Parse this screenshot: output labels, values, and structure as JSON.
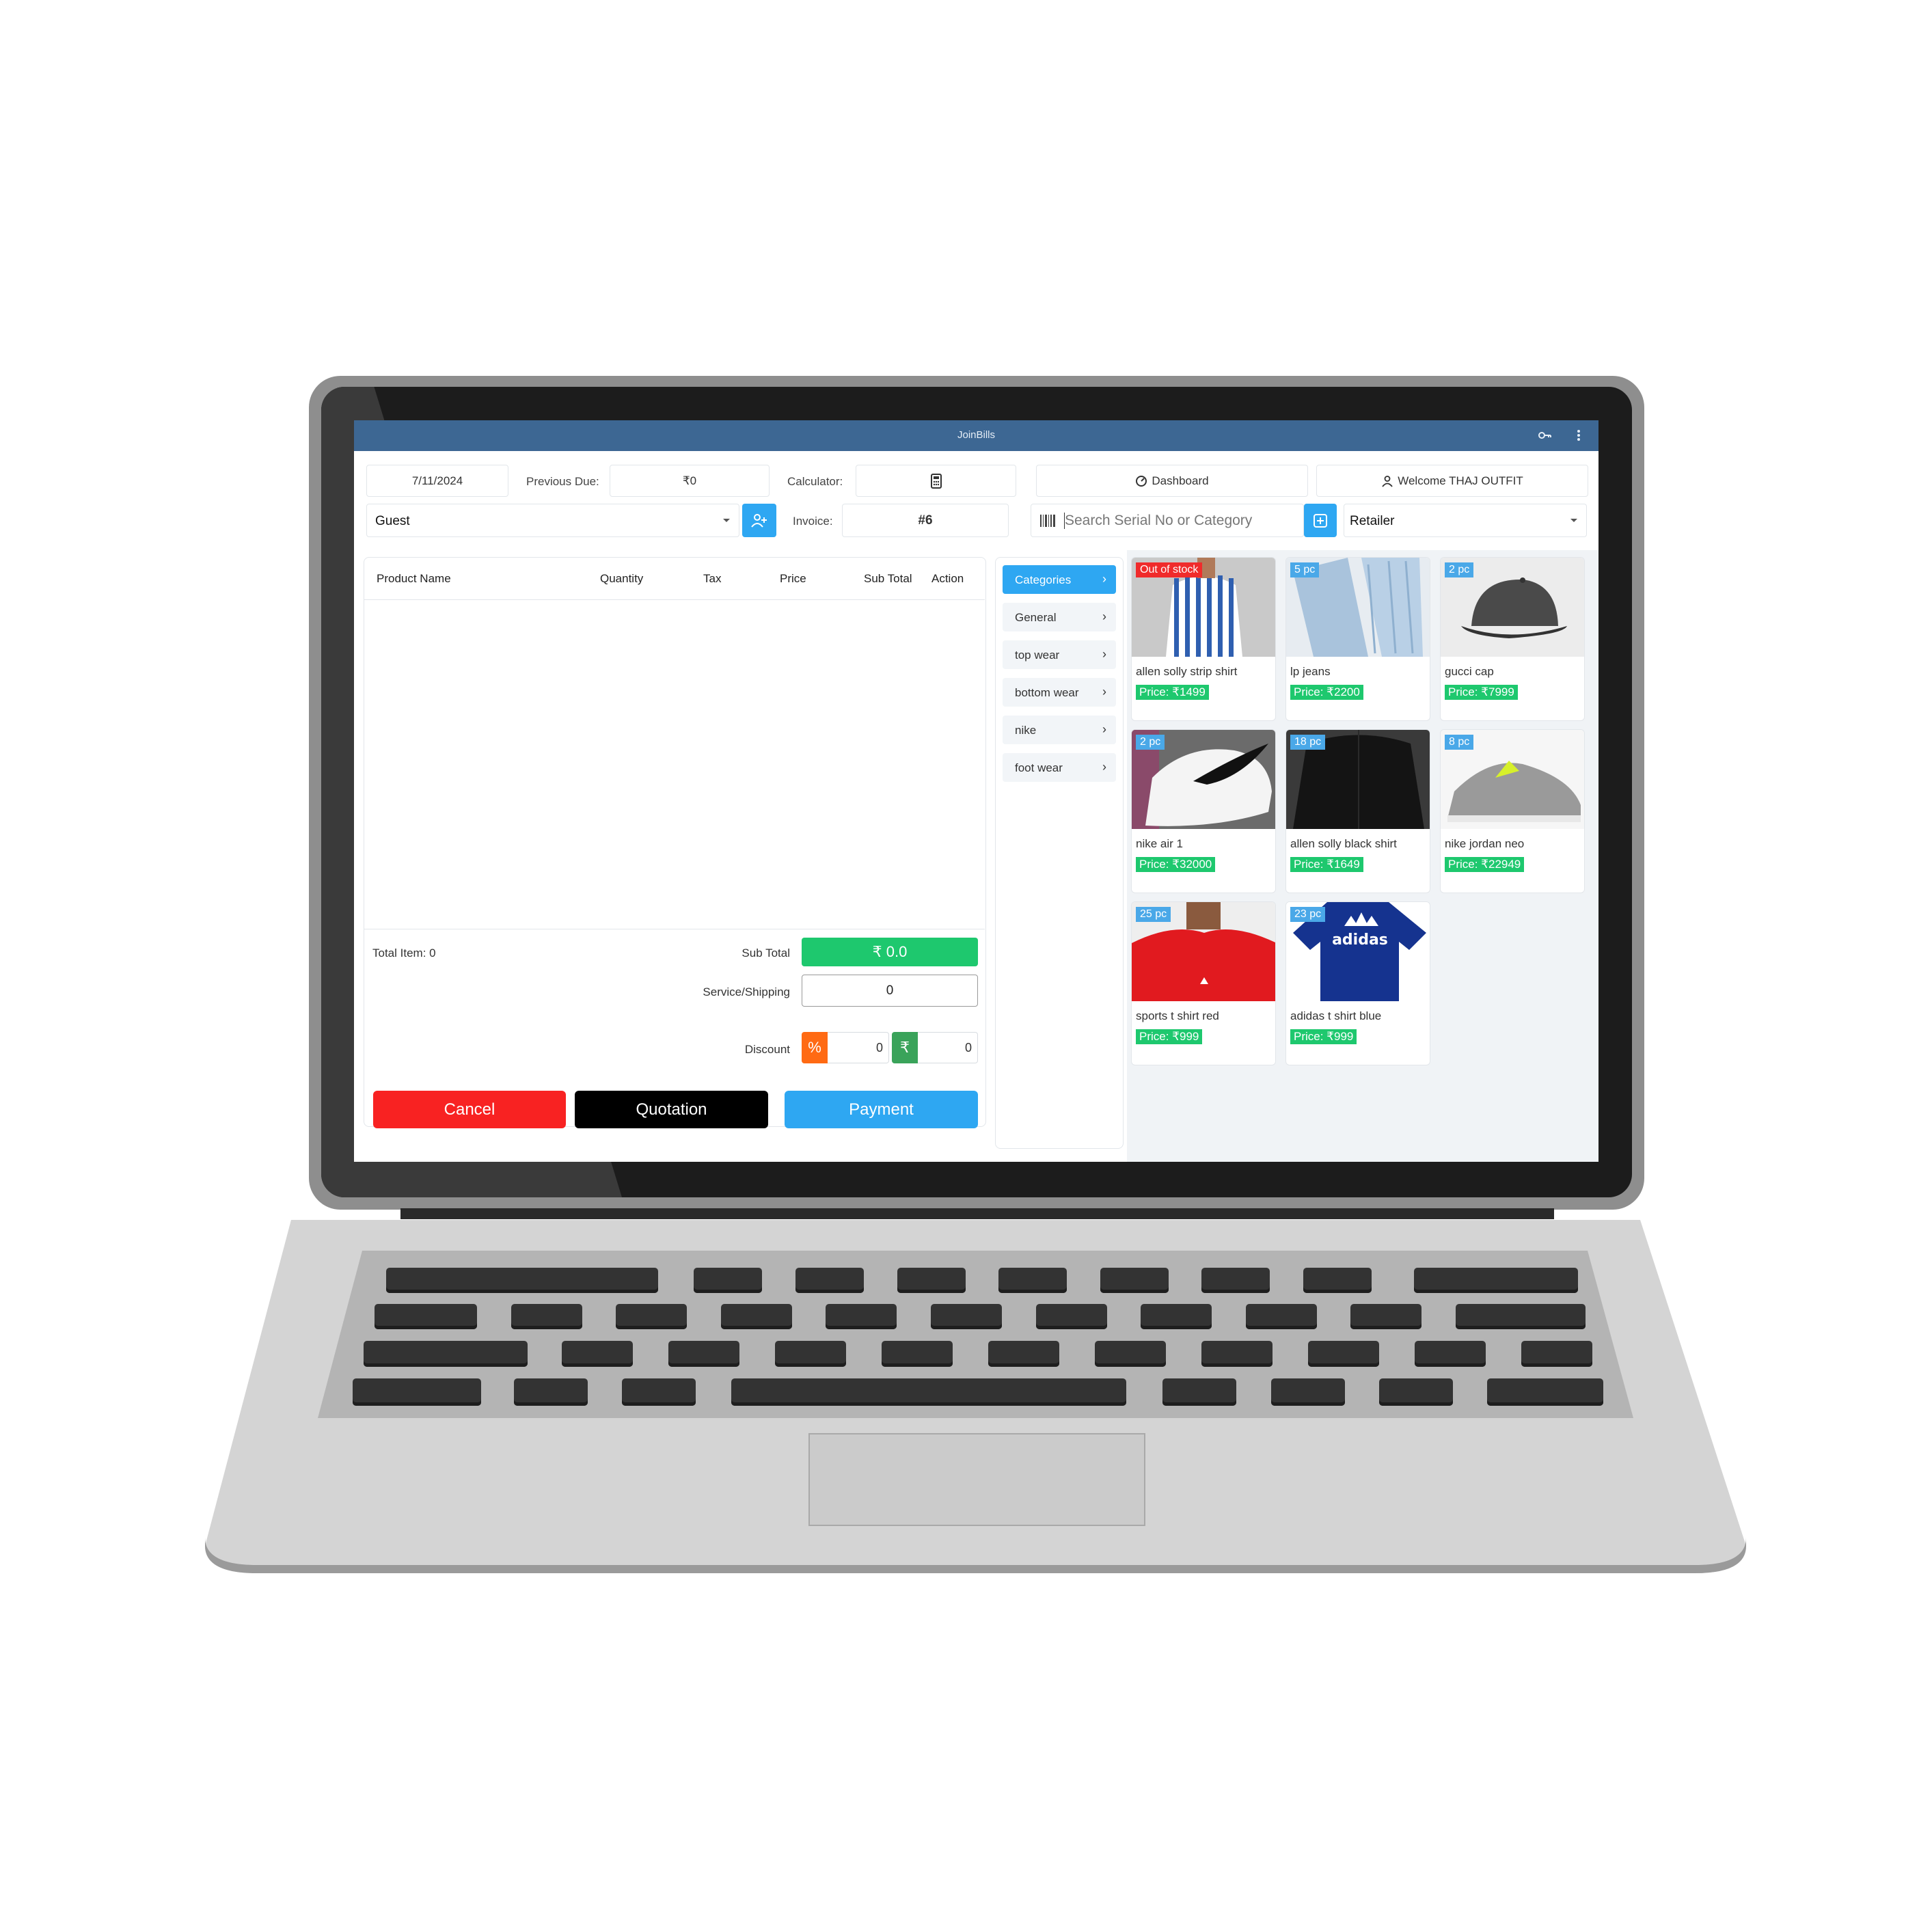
{
  "app": {
    "title": "JoinBills"
  },
  "header": {
    "date": "7/11/2024",
    "previous_due_label": "Previous Due:",
    "previous_due_value": "₹0",
    "calculator_label": "Calculator:",
    "dashboard_label": "Dashboard",
    "welcome_label": "Welcome THAJ OUTFIT",
    "customer_value": "Guest",
    "invoice_label": "Invoice:",
    "invoice_value": "#6",
    "search_placeholder": "Search Serial No or Category",
    "price_type_value": "Retailer"
  },
  "cart": {
    "columns": [
      "Product Name",
      "Quantity",
      "Tax",
      "Price",
      "Sub Total",
      "Action"
    ],
    "total_items_text": "Total Item: 0",
    "sub_total_label": "Sub Total",
    "sub_total_value": "₹ 0.0",
    "shipping_label": "Service/Shipping",
    "shipping_value": "0",
    "discount_label": "Discount",
    "discount_percent_symbol": "%",
    "discount_percent_value": "0",
    "discount_amount_symbol": "₹",
    "discount_amount_value": "0",
    "cancel_label": "Cancel",
    "quotation_label": "Quotation",
    "payment_label": "Payment"
  },
  "categories": [
    {
      "label": "Categories",
      "active": true
    },
    {
      "label": "General",
      "active": false
    },
    {
      "label": "top wear",
      "active": false
    },
    {
      "label": "bottom wear",
      "active": false
    },
    {
      "label": "nike",
      "active": false
    },
    {
      "label": "foot wear",
      "active": false
    }
  ],
  "products": [
    {
      "name": "allen solly strip shirt",
      "price": "Price: ₹1499",
      "badge": "Out of stock",
      "badge_color": "#f02b2b"
    },
    {
      "name": "lp jeans",
      "price": "Price: ₹2200",
      "badge": "5 pc",
      "badge_color": "#4aa8e8"
    },
    {
      "name": "gucci cap",
      "price": "Price: ₹7999",
      "badge": "2 pc",
      "badge_color": "#4aa8e8"
    },
    {
      "name": "nike air 1",
      "price": "Price: ₹32000",
      "badge": "2 pc",
      "badge_color": "#4aa8e8"
    },
    {
      "name": "allen solly black shirt",
      "price": "Price: ₹1649",
      "badge": "18 pc",
      "badge_color": "#4aa8e8"
    },
    {
      "name": "nike jordan neo",
      "price": "Price: ₹22949",
      "badge": "8 pc",
      "badge_color": "#4aa8e8"
    },
    {
      "name": "sports t shirt red",
      "price": "Price: ₹999",
      "badge": "25 pc",
      "badge_color": "#4aa8e8"
    },
    {
      "name": "adidas t shirt blue",
      "price": "Price: ₹999",
      "badge": "23 pc",
      "badge_color": "#4aa8e8"
    }
  ],
  "brand_text": {
    "adidas_shirt_print": "adidas"
  },
  "colors": {
    "titlebar": "#3d6793",
    "accent_blue": "#2ea7f2",
    "green": "#1ec86e",
    "cancel_red": "#f82222",
    "quotation_black": "#000000",
    "discount_orange": "#ff6a13",
    "discount_green": "#3aa35a"
  },
  "icons": [
    "calculator-icon",
    "dashboard-icon",
    "user-icon",
    "add-user-icon",
    "barcode-icon",
    "add-box-icon",
    "key-icon",
    "more-vertical-icon",
    "chevron-down-icon",
    "chevron-right-icon"
  ]
}
